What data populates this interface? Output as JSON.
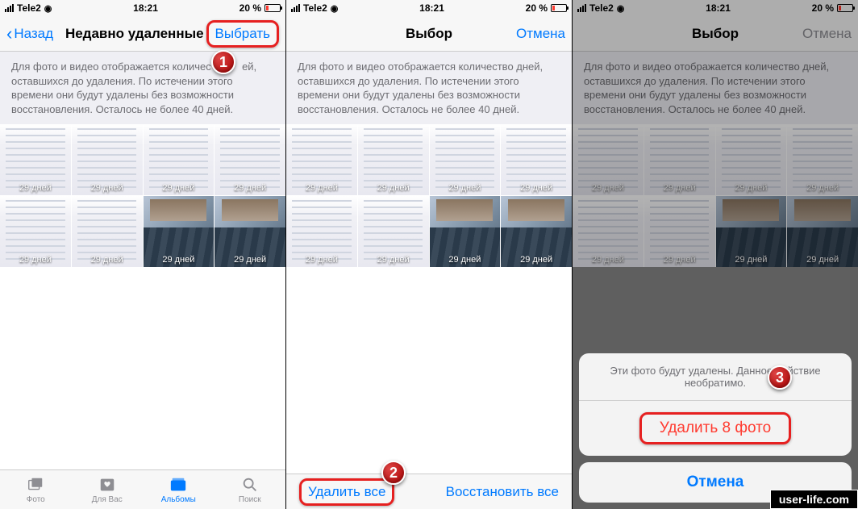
{
  "status": {
    "carrier": "Tele2",
    "time": "18:21",
    "battery_pct": "20 %"
  },
  "screen1": {
    "back": "Назад",
    "title": "Недавно удаленные",
    "select": "Выбрать"
  },
  "screen2": {
    "title": "Выбор",
    "cancel": "Отмена",
    "delete_all": "Удалить все",
    "restore_all": "Восстановить все"
  },
  "screen3": {
    "title": "Выбор",
    "cancel": "Отмена",
    "sheet_msg": "Эти фото будут удалены. Данное действие необратимо.",
    "delete_n": "Удалить 8 фото",
    "sheet_cancel": "Отмена"
  },
  "info_text": "Для фото и видео отображается количество дней, оставшихся до удаления. По истечении этого времени они будут удалены без возможности восстановления. Осталось не более 40 дней.",
  "days_label": "29 дней",
  "info_text_cut": "ей,",
  "info_text_rest": "оставшихся до удаления. По истечении этого времени они будут удалены без возможности восстановления. Осталось не более 40 дней.",
  "tabs": {
    "photos": "Фото",
    "for_you": "Для Вас",
    "albums": "Альбомы",
    "search": "Поиск"
  },
  "callouts": {
    "c1": "1",
    "c2": "2",
    "c3": "3"
  },
  "watermark": "user-life.com"
}
